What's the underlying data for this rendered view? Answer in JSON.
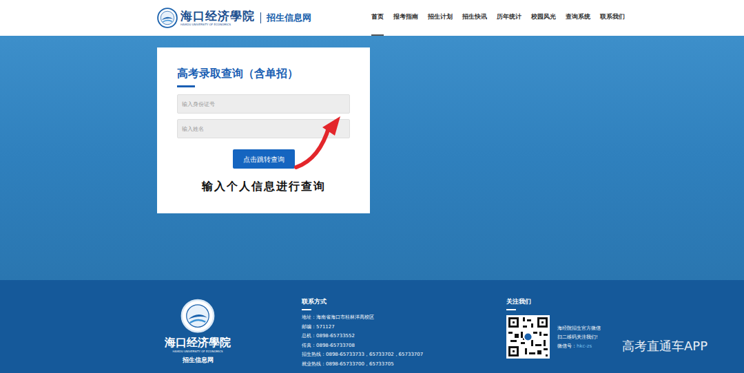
{
  "header": {
    "logo": {
      "name": "海口经济學院",
      "english": "HAIKOU UNIVERSITY OF ECONOMICS",
      "site_title": "招生信息网"
    },
    "nav": [
      {
        "label": "首页",
        "selected": true
      },
      {
        "label": "报考指南",
        "selected": false
      },
      {
        "label": "招生计划",
        "selected": false
      },
      {
        "label": "招生快讯",
        "selected": false
      },
      {
        "label": "历年统计",
        "selected": false
      },
      {
        "label": "校园风光",
        "selected": false
      },
      {
        "label": "查询系统",
        "selected": false
      },
      {
        "label": "联系我们",
        "selected": false
      }
    ]
  },
  "query_card": {
    "title": "高考录取查询（含单招）",
    "id_placeholder": "输入身份证号",
    "name_placeholder": "输入姓名",
    "button": "点击跳转查询",
    "annotation": "输入个人信息进行查询"
  },
  "footer": {
    "logo": {
      "name": "海口经济學院",
      "english": "HAIKOU UNIVERSITY OF ECONOMICS",
      "site_title": "招生信息网"
    },
    "contact": {
      "heading": "联系方式",
      "lines": [
        "地址：海南省海口市桂林洋高校区",
        "邮编：571127",
        "总机：0898-65733552",
        "传真：0898-65733708",
        "招生热线：0898-65733733，65733702，65733707",
        "就业热线：0898-65733700，65733705"
      ]
    },
    "follow": {
      "heading": "关注我们",
      "lines": [
        "海经院招生官方微信",
        "扫二维码关注我们!"
      ],
      "wechat_label": "微信号：",
      "wechat_id": "hkc-zs"
    }
  },
  "watermark": "高考直通车APP"
}
